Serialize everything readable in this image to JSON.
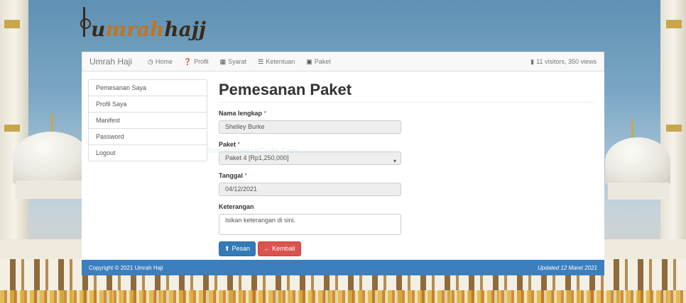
{
  "logo": {
    "part1": "u",
    "part2": "mrah",
    "part3": "hajj"
  },
  "navbar": {
    "brand": "Umrah Haji",
    "items": [
      {
        "label": "Home",
        "icon": "clock-icon"
      },
      {
        "label": "Profil",
        "icon": "question-icon"
      },
      {
        "label": "Syarat",
        "icon": "grid-icon"
      },
      {
        "label": "Ketentuan",
        "icon": "list-icon"
      },
      {
        "label": "Paket",
        "icon": "tiles-icon"
      }
    ],
    "stats": "11 visitors, 350 views"
  },
  "sidebar": {
    "items": [
      "Pemesanan Saya",
      "Profil Saya",
      "Manifest",
      "Password",
      "Logout"
    ]
  },
  "form": {
    "title": "Pemesanan Paket",
    "nama_label": "Nama lengkap",
    "nama_value": "Shelley Burke",
    "paket_label": "Paket",
    "paket_value": "Paket 4 [Rp1,250,000]",
    "tanggal_label": "Tanggal",
    "tanggal_value": "04/12/2021",
    "keterangan_label": "Keterangan",
    "keterangan_placeholder": "Isikan keterangan di sini.",
    "required_mark": "*",
    "pesan_label": "Pesan",
    "kembali_label": "Kembali"
  },
  "watermark": "RumahSourceCode.Com",
  "footer": {
    "copyright": "Copyright © 2021 Umrah Haji",
    "updated": "Updated 12 Maret 2021"
  },
  "colors": {
    "primary": "#337ab7",
    "danger": "#d9534f",
    "footer": "#3b7fbf"
  }
}
